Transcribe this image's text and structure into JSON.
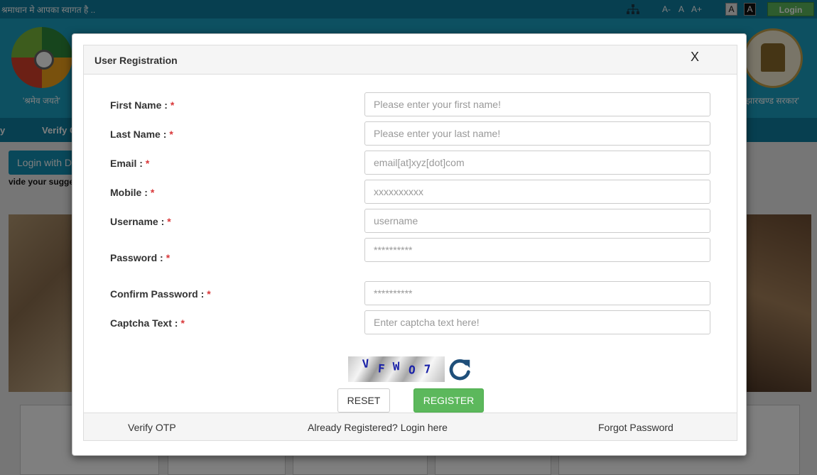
{
  "background": {
    "welcome_text": "श्रमाधान मे आपका स्वागत है ..",
    "font_size_controls": [
      "A-",
      "A",
      "A+"
    ],
    "contrast_controls": [
      "A",
      "A"
    ],
    "login_button": "Login",
    "logo_left_caption": "'श्रमेव जयते'",
    "logo_right_caption": "झारखण्ड सरकार'",
    "nav_items": [
      "y",
      "Verify C"
    ],
    "login_with_button": "Login with D",
    "suggestion_text": "vide your sugge"
  },
  "modal": {
    "title": "User Registration",
    "close_label": "X",
    "fields": [
      {
        "label": "First Name :",
        "required": "*",
        "placeholder": "Please enter your first name!"
      },
      {
        "label": "Last Name :",
        "required": "*",
        "placeholder": "Please enter your last name!"
      },
      {
        "label": "Email :",
        "required": "*",
        "placeholder": "email[at]xyz[dot]com"
      },
      {
        "label": "Mobile :",
        "required": "*",
        "placeholder": "xxxxxxxxxx"
      },
      {
        "label": "Username :",
        "required": "*",
        "placeholder": "username"
      },
      {
        "label": "Password :",
        "required": "*",
        "placeholder": "**********"
      },
      {
        "label": "Confirm Password :",
        "required": "*",
        "placeholder": "**********"
      },
      {
        "label": "Captcha Text :",
        "required": "*",
        "placeholder": "Enter captcha text here!"
      }
    ],
    "captcha": {
      "chars": [
        "V",
        "F",
        "W",
        "O",
        "7"
      ],
      "refresh_icon": "refresh-icon",
      "text_color": "#1a22a8"
    },
    "buttons": {
      "reset": "RESET",
      "register": "REGISTER",
      "register_color": "#5cb85c"
    },
    "footer": {
      "verify_otp": "Verify OTP",
      "already_registered": "Already Registered? Login here",
      "forgot_password": "Forgot Password"
    }
  }
}
